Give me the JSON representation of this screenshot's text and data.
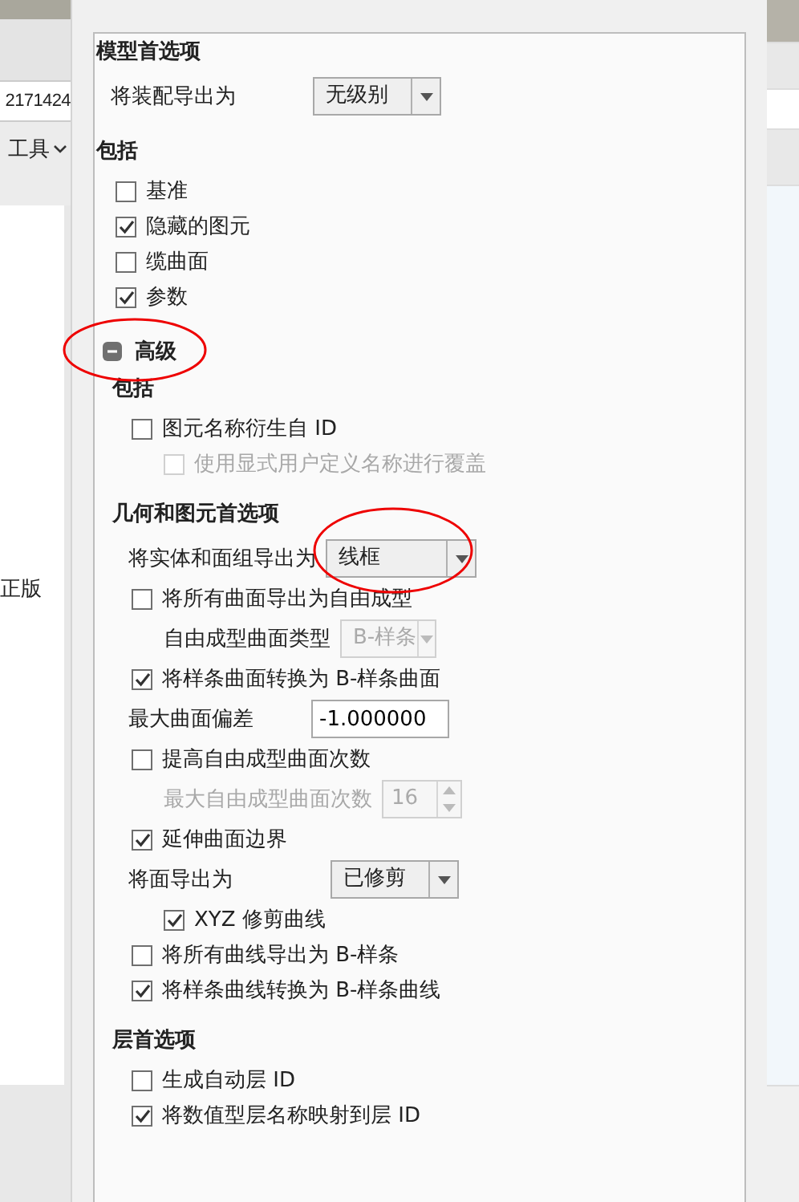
{
  "background_app": {
    "field_text": "2171424",
    "menu_label": "工具",
    "side_text": "正版"
  },
  "sections": [
    {
      "title": "模型首选项",
      "items": [
        {
          "kind": "select",
          "label": "将装配导出为",
          "value": "无级别",
          "disabled": false
        }
      ]
    },
    {
      "title": "包括",
      "items": [
        {
          "kind": "checkbox",
          "label": "基准",
          "checked": false,
          "disabled": false
        },
        {
          "kind": "checkbox",
          "label": "隐藏的图元",
          "checked": true,
          "disabled": false
        },
        {
          "kind": "checkbox",
          "label": "缆曲面",
          "checked": false,
          "disabled": false
        },
        {
          "kind": "checkbox",
          "label": "参数",
          "checked": true,
          "disabled": false
        }
      ]
    }
  ],
  "advanced": {
    "label": "高级",
    "expanded": true,
    "circled": true,
    "sections": [
      {
        "title": "包括",
        "items": [
          {
            "kind": "checkbox",
            "label": "图元名称衍生自 ID",
            "checked": false,
            "disabled": false,
            "children": [
              {
                "kind": "checkbox",
                "label": "使用显式用户定义名称进行覆盖",
                "checked": false,
                "disabled": true
              }
            ]
          }
        ]
      },
      {
        "title": "几何和图元首选项",
        "items": [
          {
            "kind": "select",
            "label": "将实体和面组导出为",
            "value": "线框",
            "disabled": false,
            "circled": true
          },
          {
            "kind": "checkbox",
            "label": "将所有曲面导出为自由成型",
            "checked": false,
            "disabled": false,
            "children": [
              {
                "kind": "select",
                "label": "自由成型曲面类型",
                "value": "B-样条",
                "disabled": true
              }
            ]
          },
          {
            "kind": "checkbox",
            "label": "将样条曲面转换为 B-样条曲面",
            "checked": true,
            "disabled": false
          },
          {
            "kind": "number",
            "label": "最大曲面偏差",
            "value": "-1.000000"
          },
          {
            "kind": "checkbox",
            "label": "提高自由成型曲面次数",
            "checked": false,
            "disabled": false,
            "children": [
              {
                "kind": "spinner",
                "label": "最大自由成型曲面次数",
                "value": "16",
                "disabled": true
              }
            ]
          },
          {
            "kind": "checkbox",
            "label": "延伸曲面边界",
            "checked": true,
            "disabled": false
          },
          {
            "kind": "select",
            "label": "将面导出为",
            "value": "已修剪",
            "disabled": false,
            "children": [
              {
                "kind": "checkbox",
                "label": "XYZ 修剪曲线",
                "checked": true,
                "disabled": false
              }
            ]
          },
          {
            "kind": "checkbox",
            "label": "将所有曲线导出为 B-样条",
            "checked": false,
            "disabled": false
          },
          {
            "kind": "checkbox",
            "label": "将样条曲线转换为 B-样条曲线",
            "checked": true,
            "disabled": false
          }
        ]
      },
      {
        "title": "层首选项",
        "items": [
          {
            "kind": "checkbox",
            "label": "生成自动层 ID",
            "checked": false,
            "disabled": false
          },
          {
            "kind": "checkbox",
            "label": "将数值型层名称映射到层 ID",
            "checked": true,
            "disabled": false
          }
        ]
      }
    ]
  }
}
